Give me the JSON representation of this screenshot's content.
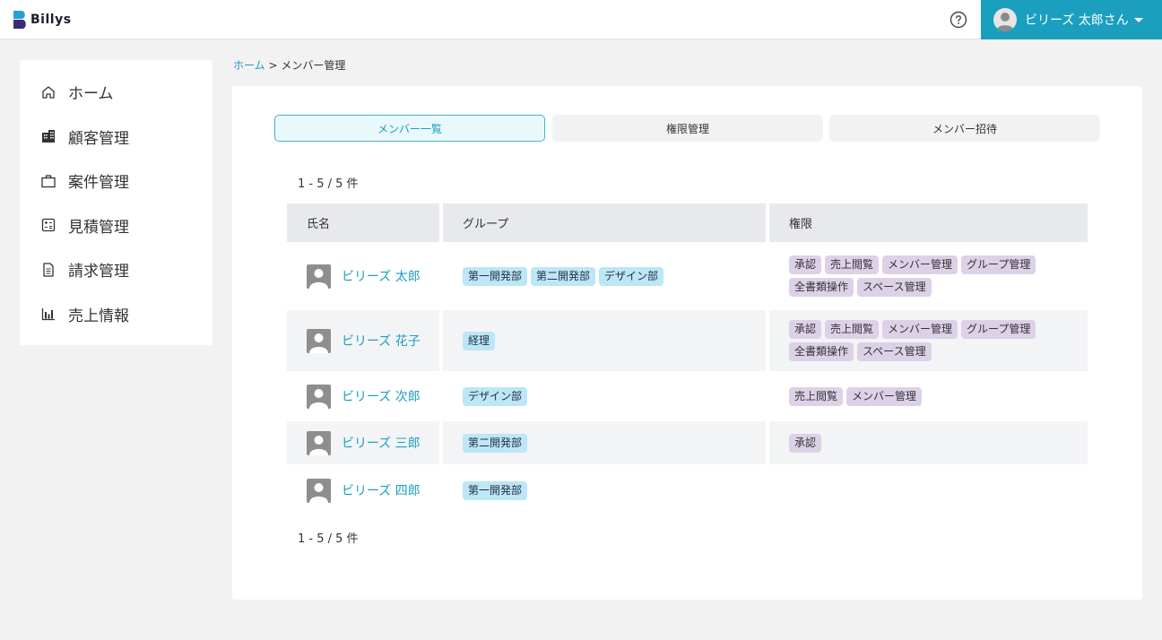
{
  "app": {
    "logo_text": "Billys"
  },
  "header": {
    "user_name": "ビリーズ 太郎さん"
  },
  "sidebar": {
    "items": [
      {
        "label": "ホーム",
        "icon": "home-icon"
      },
      {
        "label": "顧客管理",
        "icon": "building-icon"
      },
      {
        "label": "案件管理",
        "icon": "briefcase-icon"
      },
      {
        "label": "見積管理",
        "icon": "calculator-icon"
      },
      {
        "label": "請求管理",
        "icon": "document-icon"
      },
      {
        "label": "売上情報",
        "icon": "bar-chart-icon"
      }
    ]
  },
  "breadcrumb": {
    "home": "ホーム",
    "separator": ">",
    "current": "メンバー管理"
  },
  "tabs": [
    {
      "label": "メンバー一覧",
      "active": true
    },
    {
      "label": "権限管理",
      "active": false
    },
    {
      "label": "メンバー招待",
      "active": false
    }
  ],
  "count_text": "1 - 5 / 5 件",
  "table": {
    "headers": [
      "氏名",
      "グループ",
      "権限"
    ],
    "rows": [
      {
        "name": "ビリーズ 太郎",
        "groups": [
          "第一開発部",
          "第二開発部",
          "デザイン部"
        ],
        "permissions": [
          "承認",
          "売上閲覧",
          "メンバー管理",
          "グループ管理",
          "全書類操作",
          "スペース管理"
        ]
      },
      {
        "name": "ビリーズ 花子",
        "groups": [
          "経理"
        ],
        "permissions": [
          "承認",
          "売上閲覧",
          "メンバー管理",
          "グループ管理",
          "全書類操作",
          "スペース管理"
        ]
      },
      {
        "name": "ビリーズ 次郎",
        "groups": [
          "デザイン部"
        ],
        "permissions": [
          "売上閲覧",
          "メンバー管理"
        ]
      },
      {
        "name": "ビリーズ 三郎",
        "groups": [
          "第二開発部"
        ],
        "permissions": [
          "承認"
        ]
      },
      {
        "name": "ビリーズ 四郎",
        "groups": [
          "第一開発部"
        ],
        "permissions": []
      }
    ]
  },
  "colors": {
    "accent": "#1a9fbf",
    "group_tag": "#bde6f7",
    "permission_tag": "#ddd1e8"
  }
}
